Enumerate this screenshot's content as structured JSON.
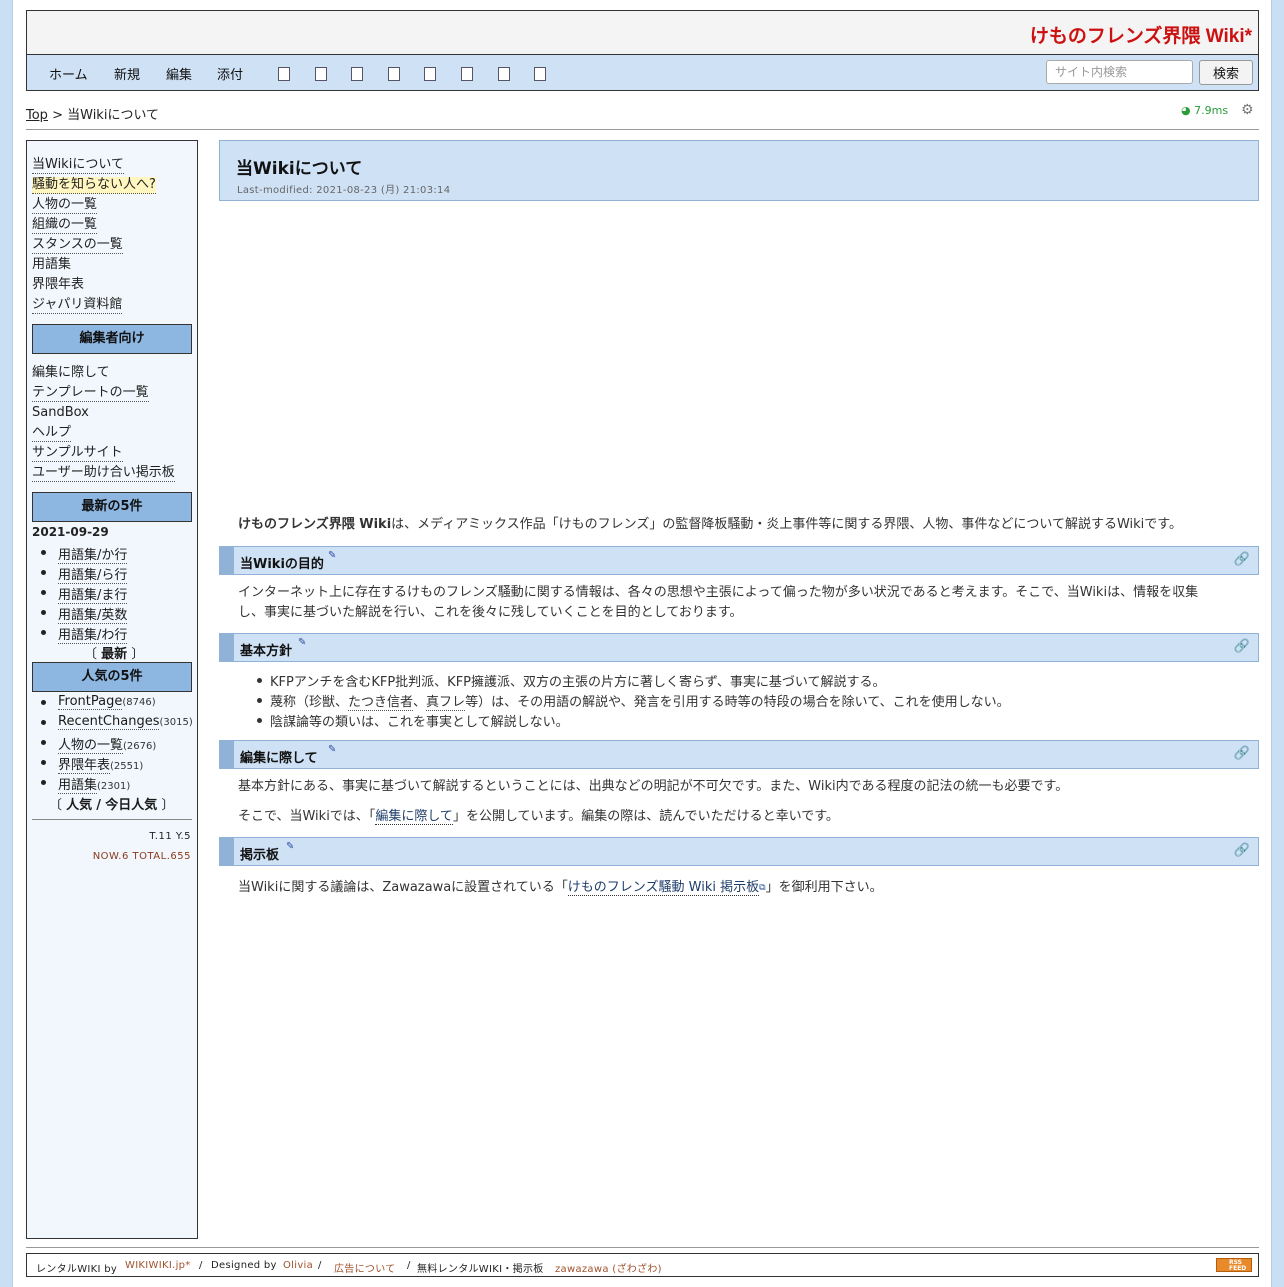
{
  "site_title": "けものフレンズ界隈 Wiki*",
  "nav": {
    "links": [
      "ホーム",
      "新規",
      "編集",
      "添付"
    ],
    "tool_icons": [
      "copy-page-icon",
      "diff-icon",
      "delete-icon",
      "save-icon",
      "lock-icon",
      "list-icon",
      "new-page-icon",
      "help-icon"
    ],
    "search_placeholder": "サイト内検索",
    "search_button": "検索"
  },
  "breadcrumb": {
    "top": "Top",
    "sep": ">",
    "current": "当Wikiについて"
  },
  "perf": "7.9ms",
  "sidebar": {
    "links": [
      "当Wikiについて",
      "騒動を知らない人へ?",
      "人物の一覧",
      "組織の一覧",
      "スタンスの一覧",
      "用語集",
      "界隈年表",
      "ジャパリ資料館"
    ],
    "editor_heading": "編集者向け",
    "editor_links": [
      "編集に際して",
      "テンプレートの一覧",
      "SandBox",
      "ヘルプ",
      "サンプルサイト",
      "ユーザー助け合い掲示板"
    ],
    "recent_heading": "最新の5件",
    "recent_date": "2021-09-29",
    "recent_items": [
      "用語集/か行",
      "用語集/ら行",
      "用語集/ま行",
      "用語集/英数",
      "用語集/わ行"
    ],
    "recent_more": "最新",
    "popular_heading": "人気の5件",
    "popular_items": [
      {
        "name": "FrontPage",
        "count": "(8746)"
      },
      {
        "name": "RecentChanges",
        "count": "(3015)"
      },
      {
        "name": "人物の一覧",
        "count": "(2676)"
      },
      {
        "name": "界隈年表",
        "count": "(2551)"
      },
      {
        "name": "用語集",
        "count": "(2301)"
      }
    ],
    "popular_more_1": "人気",
    "popular_more_sep": "/",
    "popular_more_2": "今日人気",
    "counter_ty": "T.11 Y.5",
    "counter_now": "NOW.6 TOTAL.655"
  },
  "main": {
    "title": "当Wikiについて",
    "last_modified": "Last-modified: 2021-08-23 (月) 21:03:14",
    "intro_bold": "けものフレンズ界隈 Wiki",
    "intro_rest": "は、メディアミックス作品「けものフレンズ」の監督降板騒動・炎上事件等に関する界隈、人物、事件などについて解説するWikiです。",
    "sections": [
      {
        "heading": "当Wikiの目的",
        "text_1": "インターネット上に存在するけものフレンズ騒動に関する情報は、各々の思想や主張によって偏った物が多い状況であると考えます。そこで、当Wikiは、情報を収集",
        "text_2": "し、事実に基づいた解説を行い、これを後々に残していくことを目的としております。"
      },
      {
        "heading": "基本方針",
        "items": [
          "KFPアンチを含むKFP批判派、KFP擁護派、双方の主張の片方に著しく寄らず、事実に基づいて解説する。",
          "陰謀論等の類いは、これを事実として解説しない。"
        ],
        "item2_pre": "蔑称（珍獣、",
        "item2_link1": "たつき信者",
        "item2_mid": "、",
        "item2_link2": "真フレ",
        "item2_post": "等）は、その用語の解説や、発言を引用する時等の特段の場合を除いて、これを使用しない。"
      },
      {
        "heading": "編集に際して",
        "text_1": "基本方針にある、事実に基づいて解説するということには、出典などの明記が不可欠です。また、Wiki内である程度の記法の統一も必要です。",
        "text_2_pre": "そこで、当Wikiでは、「",
        "text_2_link": "編集に際して",
        "text_2_post": "」を公開しています。編集の際は、読んでいただけると幸いです。"
      },
      {
        "heading": "掲示板",
        "text_pre": "当Wikiに関する議論は、Zawazawaに設置されている「",
        "text_link": "けものフレンズ騒動 Wiki 掲示板",
        "text_post": "」を御利用下さい。"
      }
    ]
  },
  "footer": {
    "rental": "レンタルWIKI by",
    "wikiwiki": "WIKIWIKI.jp*",
    "sep": "/",
    "designed": "Designed by",
    "olivia": "Olivia",
    "ads": "広告について",
    "free": "無料レンタルWIKI・掲示板",
    "zawazawa": "zawazawa (ざわざわ)",
    "rss": "RSS FEED"
  }
}
